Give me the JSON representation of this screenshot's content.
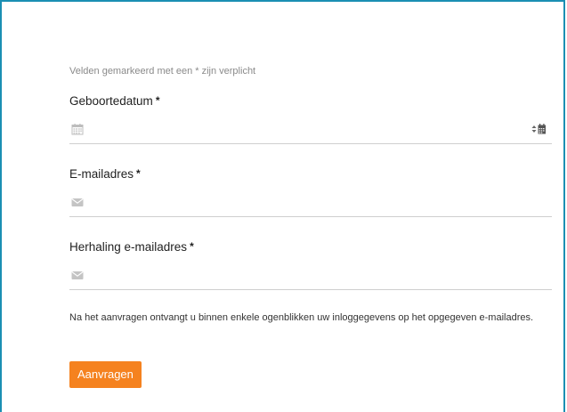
{
  "form": {
    "required_note": "Velden gemarkeerd met een * zijn verplicht",
    "required_marker": "*",
    "fields": [
      {
        "label": "Geboortedatum",
        "icon": "calendar-icon",
        "value": "",
        "placeholder": ""
      },
      {
        "label": "E-mailadres",
        "icon": "envelope-icon",
        "value": "",
        "placeholder": ""
      },
      {
        "label": "Herhaling e-mailadres",
        "icon": "envelope-icon",
        "value": "",
        "placeholder": ""
      }
    ],
    "info_text": "Na het aanvragen ontvangt u binnen enkele ogenblikken uw inloggegevens op het opgegeven e-mailadres.",
    "submit_label": "Aanvragen"
  },
  "colors": {
    "frame_border": "#1b8fb3",
    "button_bg": "#f5821f",
    "input_underline": "#cfcfcf",
    "icon_gray": "#b5b5b5"
  }
}
